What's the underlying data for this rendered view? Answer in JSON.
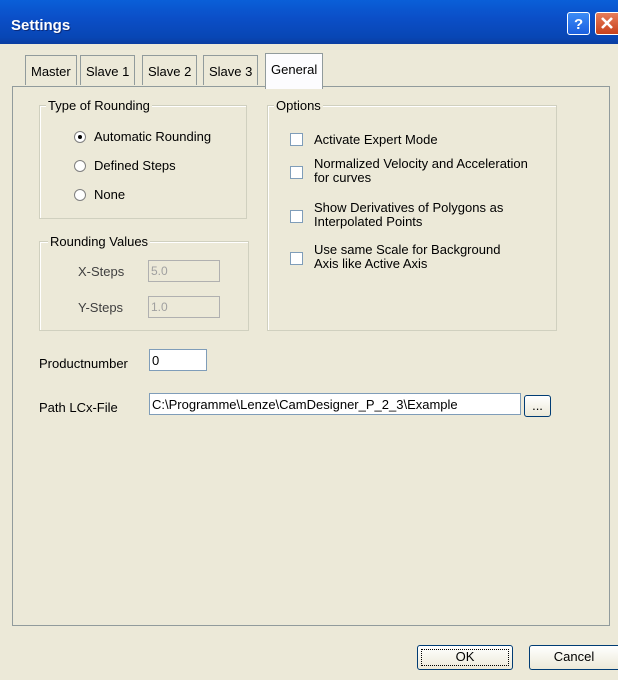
{
  "window": {
    "title": "Settings",
    "help_icon": "help-icon",
    "close_icon": "close-icon"
  },
  "tabs": [
    {
      "label": "Master"
    },
    {
      "label": "Slave 1"
    },
    {
      "label": "Slave 2"
    },
    {
      "label": "Slave 3"
    },
    {
      "label": "General",
      "active": true
    }
  ],
  "rounding": {
    "legend": "Type of Rounding",
    "options": [
      {
        "label": "Automatic Rounding",
        "selected": true
      },
      {
        "label": "Defined Steps",
        "selected": false
      },
      {
        "label": "None",
        "selected": false
      }
    ]
  },
  "rounding_values": {
    "legend": "Rounding Values",
    "x_label": "X-Steps",
    "x_value": "5.0",
    "y_label": "Y-Steps",
    "y_value": "1.0"
  },
  "options": {
    "legend": "Options",
    "items": [
      {
        "line1": "Activate Expert Mode",
        "line2": "",
        "checked": false
      },
      {
        "line1": "Normalized Velocity and Acceleration",
        "line2": "for curves",
        "checked": false
      },
      {
        "line1": "Show Derivatives of Polygons as",
        "line2": "Interpolated Points",
        "checked": false
      },
      {
        "line1": "Use same Scale for Background",
        "line2": "Axis like Active Axis",
        "checked": false
      }
    ]
  },
  "product": {
    "label": "Productnumber",
    "value": "0"
  },
  "path": {
    "label": "Path LCx-File",
    "value": "C:\\Programme\\Lenze\\CamDesigner_P_2_3\\Example",
    "browse_label": "..."
  },
  "buttons": {
    "ok": "OK",
    "cancel": "Cancel"
  }
}
